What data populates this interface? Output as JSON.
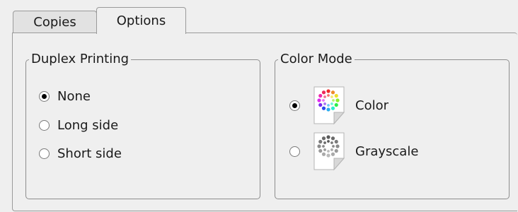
{
  "tabs": [
    {
      "label": "Copies",
      "active": false
    },
    {
      "label": "Options",
      "active": true
    }
  ],
  "duplex": {
    "title": "Duplex Printing",
    "options": [
      {
        "label": "None",
        "checked": true
      },
      {
        "label": "Long side",
        "checked": false
      },
      {
        "label": "Short side",
        "checked": false
      }
    ]
  },
  "color_mode": {
    "title": "Color Mode",
    "options": [
      {
        "label": "Color",
        "checked": true,
        "icon": "color-wheel-icon"
      },
      {
        "label": "Grayscale",
        "checked": false,
        "icon": "grayscale-wheel-icon"
      }
    ]
  },
  "colors": {
    "background": "#efefef",
    "border": "#9a9a9a",
    "radio_dot": "#000000"
  }
}
